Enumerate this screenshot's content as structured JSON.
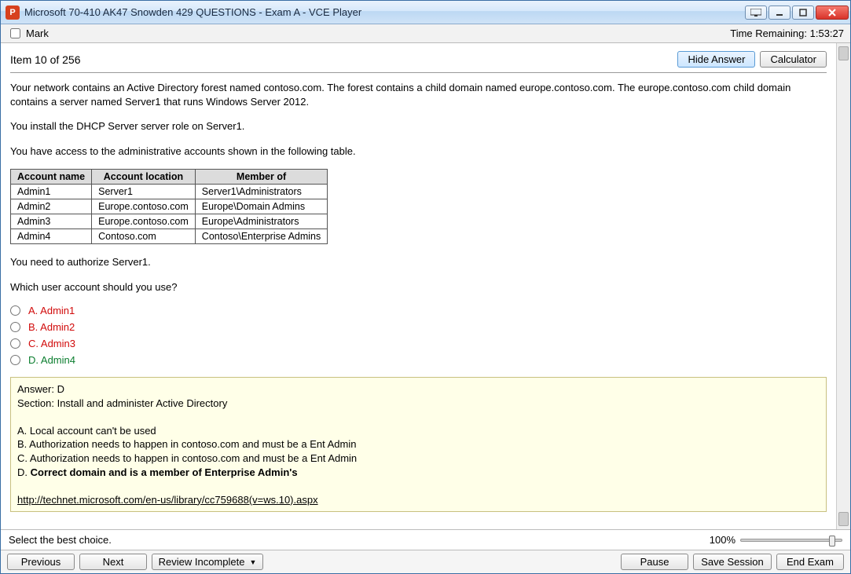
{
  "window": {
    "app_icon_letter": "P",
    "title": "Microsoft 70-410 AK47 Snowden 429 QUESTIONS - Exam A - VCE Player"
  },
  "markbar": {
    "mark_label": "Mark",
    "time_label": "Time Remaining: 1:53:27"
  },
  "toprow": {
    "item_label": "Item 10 of 256",
    "hide_answer": "Hide Answer",
    "calculator": "Calculator"
  },
  "question": {
    "p1": "Your network contains an Active Directory forest named contoso.com. The forest contains a child domain named europe.contoso.com. The europe.contoso.com child domain contains a server named Server1 that runs Windows Server 2012.",
    "p2": "You install the DHCP Server server role on Server1.",
    "p3": "You have access to the administrative accounts shown in the following table.",
    "p4": "You need to authorize Server1.",
    "p5": "Which user account should you use?"
  },
  "table": {
    "headers": [
      "Account name",
      "Account location",
      "Member of"
    ],
    "rows": [
      [
        "Admin1",
        "Server1",
        "Server1\\Administrators"
      ],
      [
        "Admin2",
        "Europe.contoso.com",
        "Europe\\Domain Admins"
      ],
      [
        "Admin3",
        "Europe.contoso.com",
        "Europe\\Administrators"
      ],
      [
        "Admin4",
        "Contoso.com",
        "Contoso\\Enterprise Admins"
      ]
    ]
  },
  "options": {
    "a": "A.  Admin1",
    "b": "B.  Admin2",
    "c": "C.  Admin3",
    "d": "D.  Admin4"
  },
  "answer": {
    "line1": "Answer: D",
    "line2": "Section: Install and administer Active Directory",
    "expA": "A. Local account can't be used",
    "expB": "B. Authorization needs to happen in contoso.com and must be a Ent Admin",
    "expC": "C. Authorization needs to happen in contoso.com and must be a Ent Admin",
    "expD_prefix": "D. ",
    "expD_bold": "Correct domain and is a member of Enterprise Admin's",
    "link": "http://technet.microsoft.com/en-us/library/cc759688(v=ws.10).aspx"
  },
  "status": {
    "instruction": "Select the best choice.",
    "zoom": "100%"
  },
  "nav": {
    "previous": "Previous",
    "next": "Next",
    "review": "Review Incomplete",
    "pause": "Pause",
    "save": "Save Session",
    "end": "End Exam"
  }
}
